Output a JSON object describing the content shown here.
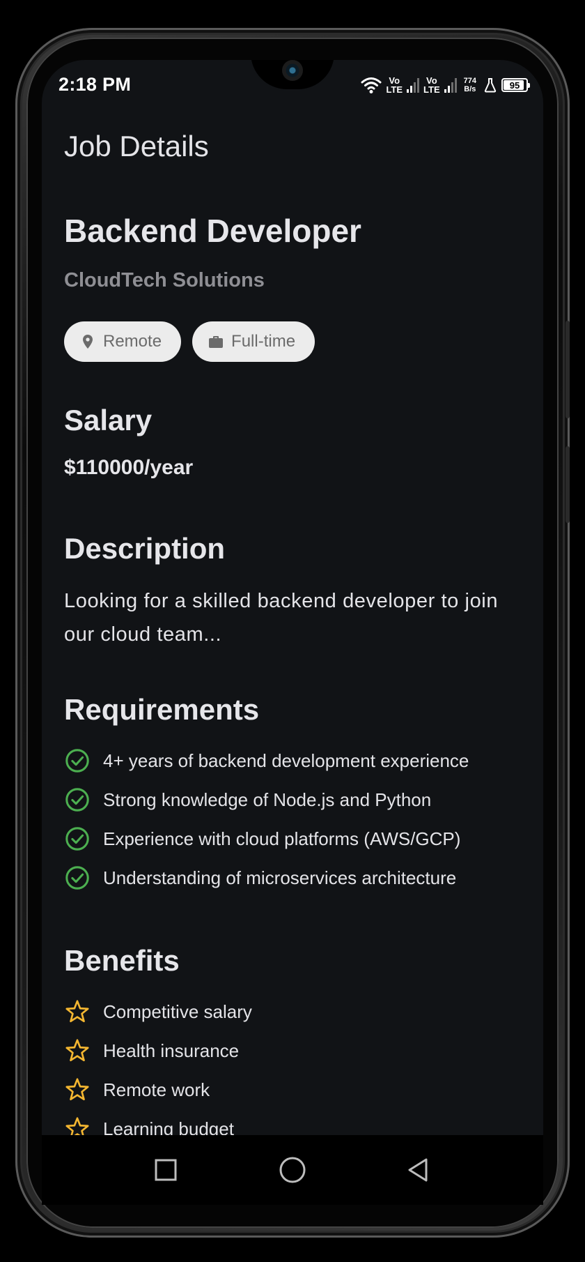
{
  "status_bar": {
    "time": "2:18 PM",
    "volte_1_top": "Vo",
    "volte_1_bottom": "LTE",
    "volte_2_top": "Vo",
    "volte_2_bottom": "LTE",
    "net_speed_value": "774",
    "net_speed_unit": "B/s",
    "battery_level": "95"
  },
  "header": {
    "title": "Job Details"
  },
  "job": {
    "title": "Backend Developer",
    "company": "CloudTech Solutions",
    "chips": [
      {
        "label": "Remote",
        "icon": "location-pin-icon"
      },
      {
        "label": "Full-time",
        "icon": "briefcase-icon"
      }
    ]
  },
  "salary": {
    "heading": "Salary",
    "value": "$110000/year"
  },
  "description": {
    "heading": "Description",
    "text": "Looking for a skilled backend developer to join our cloud team..."
  },
  "requirements": {
    "heading": "Requirements",
    "icon": "check-circle-icon",
    "icon_color": "#4caf50",
    "items": [
      "4+ years of backend development experience",
      "Strong knowledge of Node.js and Python",
      "Experience with cloud platforms (AWS/GCP)",
      "Understanding of microservices architecture"
    ]
  },
  "benefits": {
    "heading": "Benefits",
    "icon": "star-outline-icon",
    "icon_color": "#f5b731",
    "items": [
      "Competitive salary",
      "Health insurance",
      "Remote work",
      "Learning budget"
    ]
  },
  "nav_bar": {
    "buttons": [
      "recent-apps-icon",
      "home-icon",
      "back-icon"
    ]
  },
  "colors": {
    "background": "#111316",
    "text_primary": "#e6e6ea",
    "text_secondary": "#8f8f94",
    "chip_background": "#ececec"
  }
}
